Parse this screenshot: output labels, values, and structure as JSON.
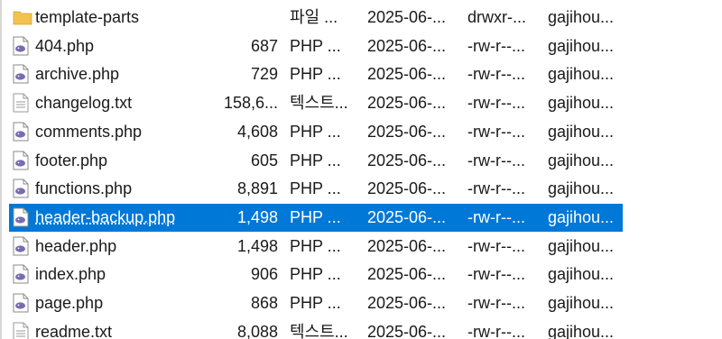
{
  "file_list": {
    "rows": [
      {
        "icon": "folder-icon",
        "name": "template-parts",
        "size": "",
        "type": "파일 ...",
        "date": "2025-06-...",
        "perm": "drwxr-...",
        "owner": "gajihou...",
        "selected": false
      },
      {
        "icon": "php-file-icon",
        "name": "404.php",
        "size": "687",
        "type": "PHP ...",
        "date": "2025-06-...",
        "perm": "-rw-r--...",
        "owner": "gajihou...",
        "selected": false
      },
      {
        "icon": "php-file-icon",
        "name": "archive.php",
        "size": "729",
        "type": "PHP ...",
        "date": "2025-06-...",
        "perm": "-rw-r--...",
        "owner": "gajihou...",
        "selected": false
      },
      {
        "icon": "text-file-icon",
        "name": "changelog.txt",
        "size": "158,6...",
        "type": "텍스트...",
        "date": "2025-06-...",
        "perm": "-rw-r--...",
        "owner": "gajihou...",
        "selected": false
      },
      {
        "icon": "php-file-icon",
        "name": "comments.php",
        "size": "4,608",
        "type": "PHP ...",
        "date": "2025-06-...",
        "perm": "-rw-r--...",
        "owner": "gajihou...",
        "selected": false
      },
      {
        "icon": "php-file-icon",
        "name": "footer.php",
        "size": "605",
        "type": "PHP ...",
        "date": "2025-06-...",
        "perm": "-rw-r--...",
        "owner": "gajihou...",
        "selected": false
      },
      {
        "icon": "php-file-icon",
        "name": "functions.php",
        "size": "8,891",
        "type": "PHP ...",
        "date": "2025-06-...",
        "perm": "-rw-r--...",
        "owner": "gajihou...",
        "selected": false
      },
      {
        "icon": "php-file-icon",
        "name": "header-backup.php",
        "size": "1,498",
        "type": "PHP ...",
        "date": "2025-06-...",
        "perm": "-rw-r--...",
        "owner": "gajihou...",
        "selected": true
      },
      {
        "icon": "php-file-icon",
        "name": "header.php",
        "size": "1,498",
        "type": "PHP ...",
        "date": "2025-06-...",
        "perm": "-rw-r--...",
        "owner": "gajihou...",
        "selected": false
      },
      {
        "icon": "php-file-icon",
        "name": "index.php",
        "size": "906",
        "type": "PHP ...",
        "date": "2025-06-...",
        "perm": "-rw-r--...",
        "owner": "gajihou...",
        "selected": false
      },
      {
        "icon": "php-file-icon",
        "name": "page.php",
        "size": "868",
        "type": "PHP ...",
        "date": "2025-06-...",
        "perm": "-rw-r--...",
        "owner": "gajihou...",
        "selected": false
      },
      {
        "icon": "text-file-icon",
        "name": "readme.txt",
        "size": "8,088",
        "type": "텍스트...",
        "date": "2025-06-...",
        "perm": "-rw-r--...",
        "owner": "gajihou...",
        "selected": false
      }
    ]
  },
  "colors": {
    "selection": "#0078d7",
    "folder": "#f2c14e",
    "php_icon": "#7a6ab0",
    "text_icon": "#9a9a9a"
  }
}
